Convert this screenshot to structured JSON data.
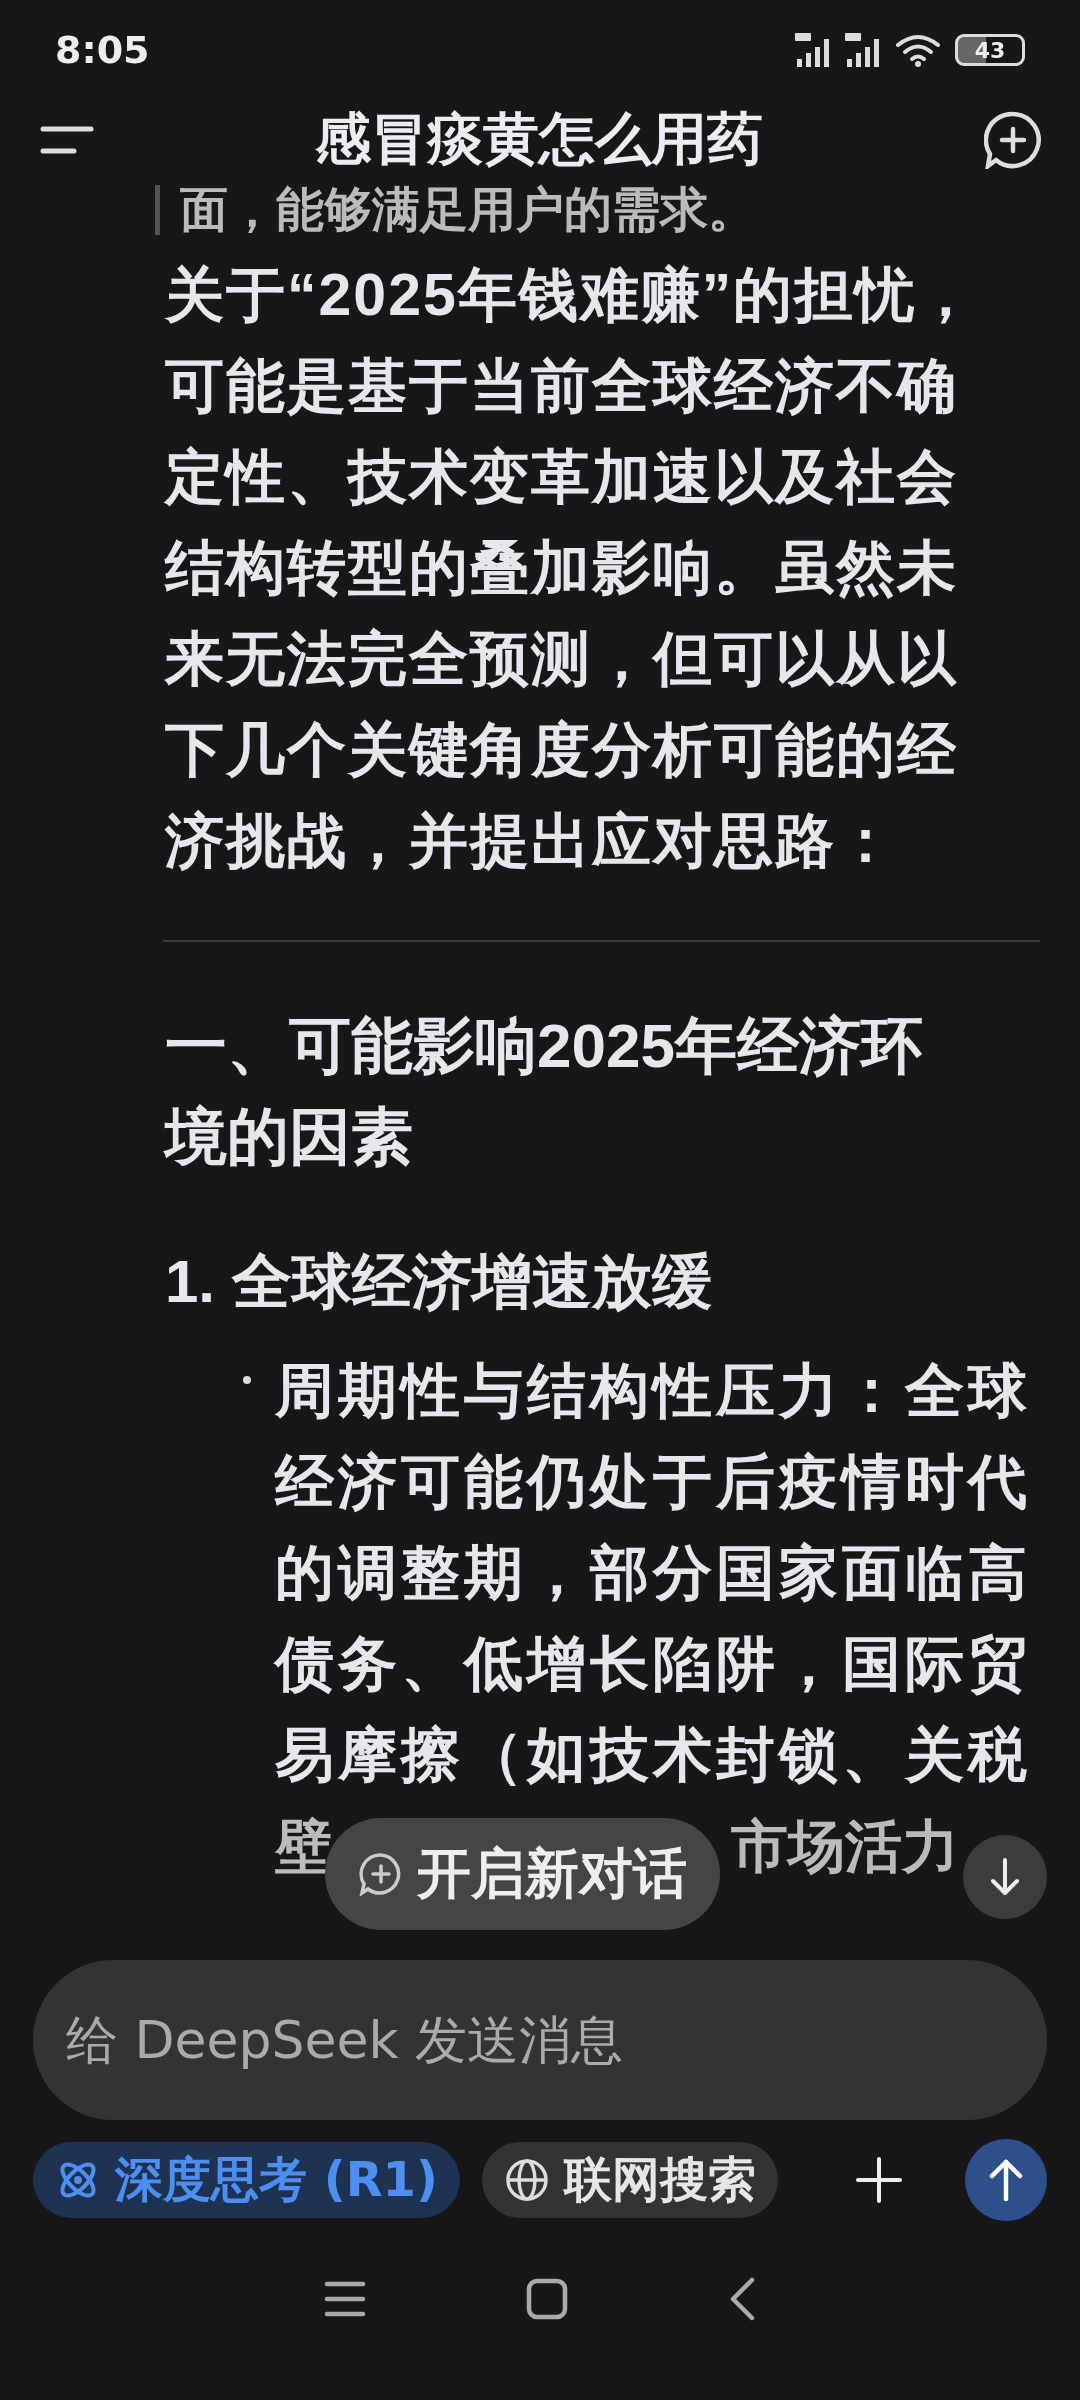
{
  "status_bar": {
    "time": "8:05",
    "battery": "43"
  },
  "header": {
    "title": "感冒痰黄怎么用药"
  },
  "message": {
    "quote_tail": "面，能够满足用户的需求。",
    "intro": "关于“2025年钱难赚”的担忧，可能是基于当前全球经济不确定性、技术变革加速以及社会结构转型的叠加影响。虽然未来无法完全预测，但可以从以下几个关键角度分析可能的经济挑战，并提出应对思路：",
    "heading": "一、可能影响2025年经济环境的因素",
    "subheading": "1. 全球经济增速放缓",
    "bullet": {
      "text": "周期性与结构性压力：全球经济可能仍处于后疫情时代的调整期，部分国家面临高债务、低增长陷阱，国际贸易摩擦（如技术封锁、关税",
      "covered_line": [
        "壁",
        "市场活力"
      ]
    }
  },
  "new_chat_button": "开启新对话",
  "composer": {
    "placeholder": "给 DeepSeek 发送消息",
    "toggles": [
      {
        "kind": "think",
        "label": "深度思考 (R1)",
        "selected": true
      },
      {
        "kind": "search",
        "label": "联网搜索",
        "selected": false
      }
    ]
  }
}
